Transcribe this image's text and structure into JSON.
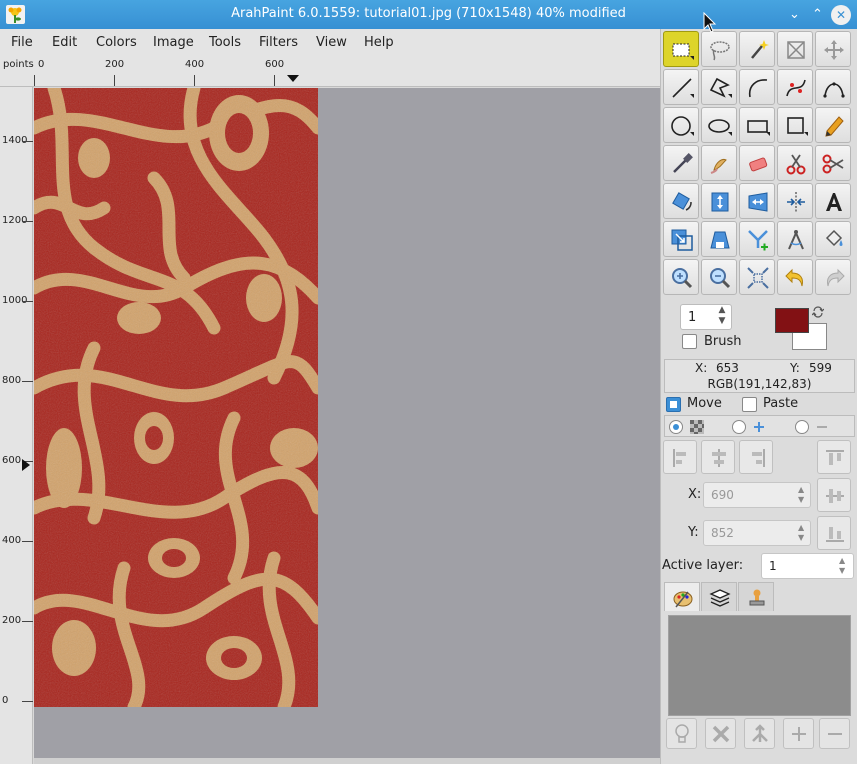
{
  "window": {
    "title": "ArahPaint 6.0.1559: tutorial01.jpg (710x1548) 40% modified",
    "minimize_glyph": "⌄",
    "maximize_glyph": "⌃",
    "close_glyph": "✕"
  },
  "menu": [
    "File",
    "Edit",
    "Colors",
    "Image",
    "Tools",
    "Filters",
    "View",
    "Help"
  ],
  "ruler": {
    "unit": "points",
    "horizontal_labels": [
      "0",
      "200",
      "400",
      "600"
    ],
    "vertical_labels": [
      "1400",
      "1200",
      "1000",
      "800",
      "600",
      "400",
      "200",
      "0"
    ]
  },
  "tools": [
    {
      "name": "rectangle-select-icon",
      "active": true
    },
    {
      "name": "lasso-icon"
    },
    {
      "name": "magic-wand-icon"
    },
    {
      "name": "crop-icon"
    },
    {
      "name": "move-icon"
    },
    {
      "name": "line-icon"
    },
    {
      "name": "polygon-icon"
    },
    {
      "name": "arc-icon"
    },
    {
      "name": "curve-icon"
    },
    {
      "name": "bezier-icon"
    },
    {
      "name": "circle-icon"
    },
    {
      "name": "ellipse-icon"
    },
    {
      "name": "rectangle-icon"
    },
    {
      "name": "square-icon"
    },
    {
      "name": "pencil-icon"
    },
    {
      "name": "color-picker-icon"
    },
    {
      "name": "smudge-icon"
    },
    {
      "name": "eraser-icon"
    },
    {
      "name": "scissors-icon"
    },
    {
      "name": "cut-icon"
    },
    {
      "name": "rotate-icon"
    },
    {
      "name": "flip-vertical-icon"
    },
    {
      "name": "flip-horizontal-icon"
    },
    {
      "name": "symmetry-icon"
    },
    {
      "name": "text-icon"
    },
    {
      "name": "resize-icon"
    },
    {
      "name": "perspective-icon"
    },
    {
      "name": "split-icon"
    },
    {
      "name": "compass-icon"
    },
    {
      "name": "fill-bucket-icon"
    },
    {
      "name": "zoom-in-icon"
    },
    {
      "name": "zoom-out-icon"
    },
    {
      "name": "zoom-fit-icon"
    },
    {
      "name": "undo-icon"
    },
    {
      "name": "redo-icon"
    }
  ],
  "brush": {
    "size": "1",
    "label": "Brush",
    "checked": false
  },
  "colors": {
    "foreground": "#821114",
    "background": "#ffffff"
  },
  "info": {
    "x_label": "X:",
    "x_value": "653",
    "y_label": "Y:",
    "y_value": "599",
    "rgb": "RGB(191,142,83)"
  },
  "move_label": "Move",
  "paste_label": "Paste",
  "position": {
    "x_label": "X:",
    "x_value": "690",
    "y_label": "Y:",
    "y_value": "852"
  },
  "active_layer": {
    "label": "Active layer:",
    "value": "1"
  },
  "tabs": [
    "palette-tab-icon",
    "layers-tab-icon",
    "stamp-tab-icon"
  ],
  "layer_buttons": [
    "light-bulb-icon",
    "delete-icon",
    "merge-icon",
    "add-icon",
    "remove-icon"
  ]
}
